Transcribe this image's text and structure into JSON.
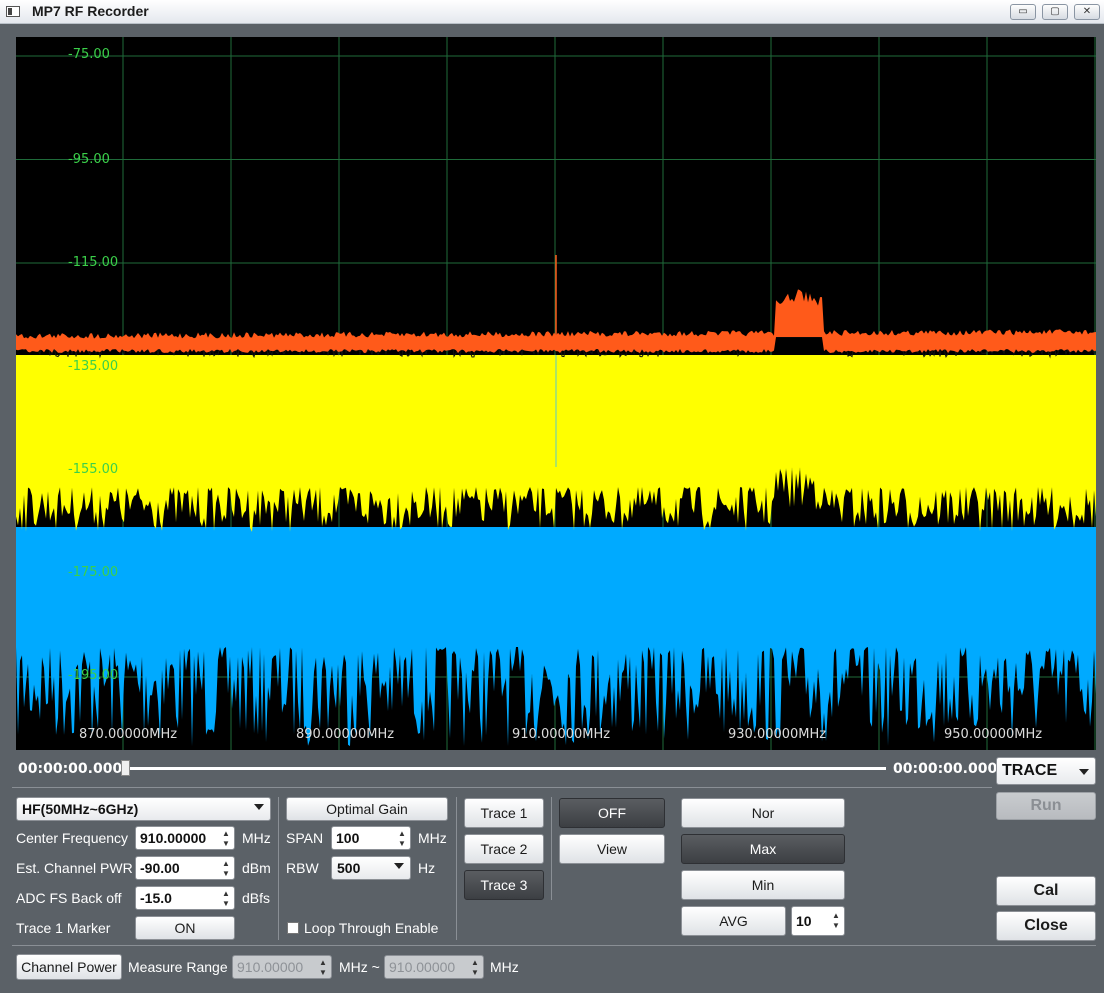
{
  "window": {
    "title": "MP7 RF Recorder",
    "controls": {
      "minimize": "▭",
      "maximize": "▢",
      "close": "✕"
    }
  },
  "spectrum": {
    "y_ticks": [
      "-75.00",
      "-95.00",
      "-115.00",
      "-135.00",
      "-155.00",
      "-175.00",
      "-195.00"
    ],
    "x_ticks": [
      "870.00000MHz",
      "890.00000MHz",
      "910.00000MHz",
      "930.00000MHz",
      "950.00000MHz"
    ],
    "colors": {
      "max": "#ff5a1a",
      "nor": "#ffff00",
      "min": "#00aaff",
      "grid": "#1f6b3a"
    }
  },
  "timeline": {
    "start": "00:00:00.000",
    "end": "00:00:00.000"
  },
  "mode_select": {
    "value": "TRACE"
  },
  "run_button": "Run",
  "band_select": {
    "value": "HF(50MHz~6GHz)"
  },
  "center_frequency": {
    "label": "Center Frequency",
    "value": "910.00000",
    "unit": "MHz"
  },
  "est_channel_pwr": {
    "label": "Est. Channel PWR",
    "value": "-90.00",
    "unit": "dBm"
  },
  "adc_fs_backoff": {
    "label": "ADC FS Back off",
    "value": "-15.0",
    "unit": "dBfs"
  },
  "trace1_marker": {
    "label": "Trace 1 Marker",
    "value": "ON"
  },
  "optimal_gain": "Optimal Gain",
  "span": {
    "label": "SPAN",
    "value": "100",
    "unit": "MHz"
  },
  "rbw": {
    "label": "RBW",
    "value": "500",
    "unit": "Hz"
  },
  "loop_through": "Loop Through Enable",
  "traces": [
    "Trace 1",
    "Trace 2",
    "Trace 3"
  ],
  "off_button": "OFF",
  "view_button": "View",
  "modes": {
    "nor": "Nor",
    "max": "Max",
    "min": "Min",
    "avg": "AVG",
    "avg_count": "10"
  },
  "cal_button": "Cal",
  "close_button": "Close",
  "channel_power": {
    "button": "Channel Power",
    "label": "Measure Range",
    "from": "910.00000",
    "sep": "MHz ~",
    "to": "910.00000",
    "unit": "MHz"
  }
}
